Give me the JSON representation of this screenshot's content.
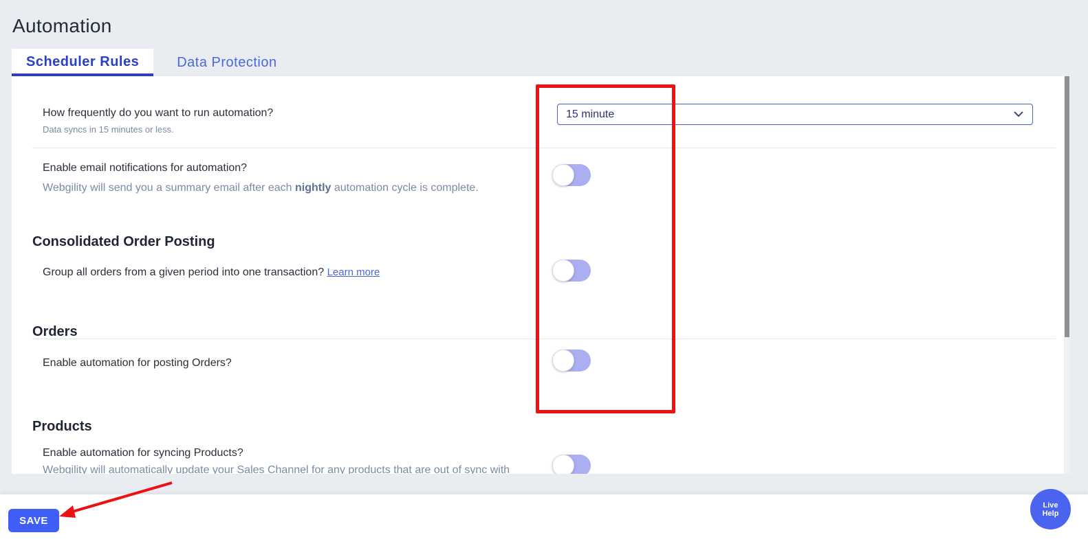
{
  "page": {
    "title": "Automation"
  },
  "tabs": [
    {
      "label": "Scheduler Rules",
      "active": true
    },
    {
      "label": "Data Protection",
      "active": false
    }
  ],
  "frequency": {
    "label": "How frequently do you want to run automation?",
    "sub": "Data syncs in 15 minutes or less.",
    "selected": "15 minute"
  },
  "email_notifications": {
    "label": "Enable email notifications for automation?",
    "sub_before": "Webgility will send you a summary email after each ",
    "sub_bold": "nightly",
    "sub_after": " automation cycle is complete.",
    "enabled": false
  },
  "consolidated": {
    "title": "Consolidated Order Posting",
    "label": "Group all orders from a given period into one transaction?",
    "link": "Learn more",
    "enabled": false
  },
  "orders": {
    "title": "Orders",
    "label": "Enable automation for posting Orders?",
    "enabled": false
  },
  "products": {
    "title": "Products",
    "label": "Enable automation for syncing Products?",
    "sub": "Webgility will automatically update your Sales Channel for any products that are out of sync with",
    "enabled": false
  },
  "footer": {
    "save_label": "SAVE"
  },
  "live_help": {
    "line1": "Live",
    "line2": "Help"
  },
  "colors": {
    "accent": "#3f5ef5",
    "toggle_track": "#a9aff0",
    "annotation": "#ee1111"
  },
  "icons": {
    "select": "chevron-down-icon"
  }
}
